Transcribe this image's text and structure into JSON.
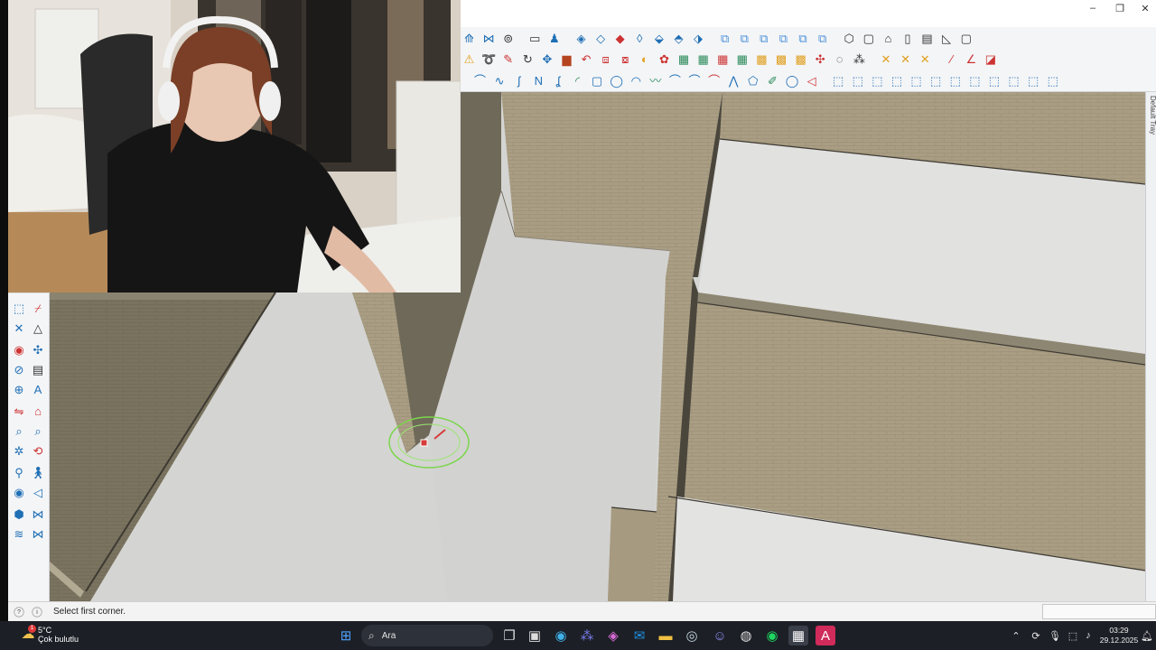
{
  "window": {
    "minimize_glyph": "–",
    "maximize_glyph": "❐",
    "close_glyph": "✕"
  },
  "tray_panel": {
    "label": "Default Tray"
  },
  "statusbar": {
    "help_glyph": "?",
    "info_glyph": "i",
    "message": "Select first corner.",
    "measurements_value": ""
  },
  "taskbar": {
    "weather_temp": "5°C",
    "weather_desc": "Çok bulutlu",
    "weather_badge": "1",
    "search_placeholder": "Ara",
    "time": "03:29",
    "date": "29.12.2025"
  },
  "icons": {
    "start": "start-icon",
    "search": "search-icon",
    "weather": "weather-cloud-icon",
    "notifications": "bell-icon"
  },
  "colors": {
    "brick_wall": "#a89c82",
    "floor": "#d4d4d2",
    "cursor_highlight": "#7bd64b",
    "taskbar": "#1c1f26",
    "toolbar_accent": "#1f6fb5"
  }
}
